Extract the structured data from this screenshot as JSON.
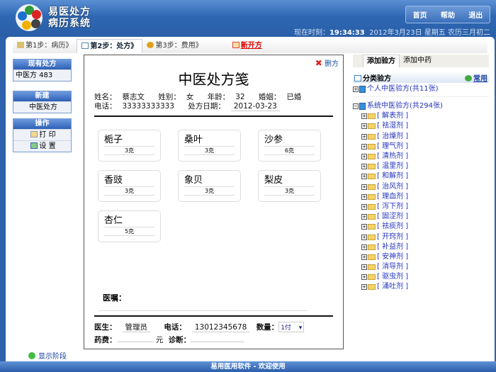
{
  "app": {
    "title_line1": "易医处方",
    "title_line2": "病历系统"
  },
  "topnav": [
    "首页",
    "帮助",
    "退出"
  ],
  "clock": {
    "label": "现在时刻：",
    "time": "19:34:33",
    "date": "2012年3月23日",
    "weekday": "星期五",
    "lunar": "农历三月初二"
  },
  "steps": [
    {
      "label": "第1步：病历》"
    },
    {
      "label": "第2步：处方》"
    },
    {
      "label": "第3步：费用》"
    },
    {
      "label": "新开方"
    }
  ],
  "sidebar": {
    "existing_header": "现有处方",
    "existing_item": "中医方 483",
    "new_header": "新建",
    "new_item": "中医处方",
    "ops_header": "操作",
    "print": "打 印",
    "settings": "设 置",
    "show_stage": "显示阶段"
  },
  "prescription": {
    "delete": "删方",
    "title": "中医处方笺",
    "name_label": "姓名：",
    "name": "蔡志文",
    "sex_label": "姓别：",
    "sex": "女",
    "age_label": "年龄：",
    "age": "32",
    "marriage_label": "婚姻：",
    "marriage": "已婚",
    "phone_label": "电话：",
    "phone": "33333333333",
    "date_label": "处方日期：",
    "date": "2012-03-23",
    "herbs": [
      {
        "name": "栀子",
        "dose": "3克"
      },
      {
        "name": "桑叶",
        "dose": "3克"
      },
      {
        "name": "沙参",
        "dose": "6克"
      },
      {
        "name": "香豉",
        "dose": "3克"
      },
      {
        "name": "象贝",
        "dose": "3克"
      },
      {
        "name": "梨皮",
        "dose": "3克"
      },
      {
        "name": "杏仁",
        "dose": "5克"
      }
    ],
    "advice_label": "医嘱：",
    "doctor_label": "医生：",
    "doctor": "管理员",
    "doctor_phone_label": "电话：",
    "doctor_phone": "13012345678",
    "qty_label": "数量：",
    "qty": "1付",
    "fee_label": "药费：",
    "fee_unit": "元",
    "diag_label": "诊断："
  },
  "right": {
    "tab_add_formula": "添加验方",
    "tab_add_herb": "添加中药",
    "cat_title": "分类验方",
    "common": "常用",
    "personal": "个人中医验方(共11张)",
    "system": "系统中医验方(共294张)",
    "categories": [
      "[ 解表剂 ]",
      "[ 祛湿剂 ]",
      "[ 治燥剂 ]",
      "[ 理气剂 ]",
      "[ 清热剂 ]",
      "[ 温里剂 ]",
      "[ 和解剂 ]",
      "[ 治风剂 ]",
      "[ 理血剂 ]",
      "[ 泻下剂 ]",
      "[ 固涩剂 ]",
      "[ 祛痰剂 ]",
      "[ 开窍剂 ]",
      "[ 补益剂 ]",
      "[ 安神剂 ]",
      "[ 消导剂 ]",
      "[ 驱虫剂 ]",
      "[ 涌吐剂 ]"
    ]
  },
  "footer": "易用医用软件 - 欢迎使用"
}
